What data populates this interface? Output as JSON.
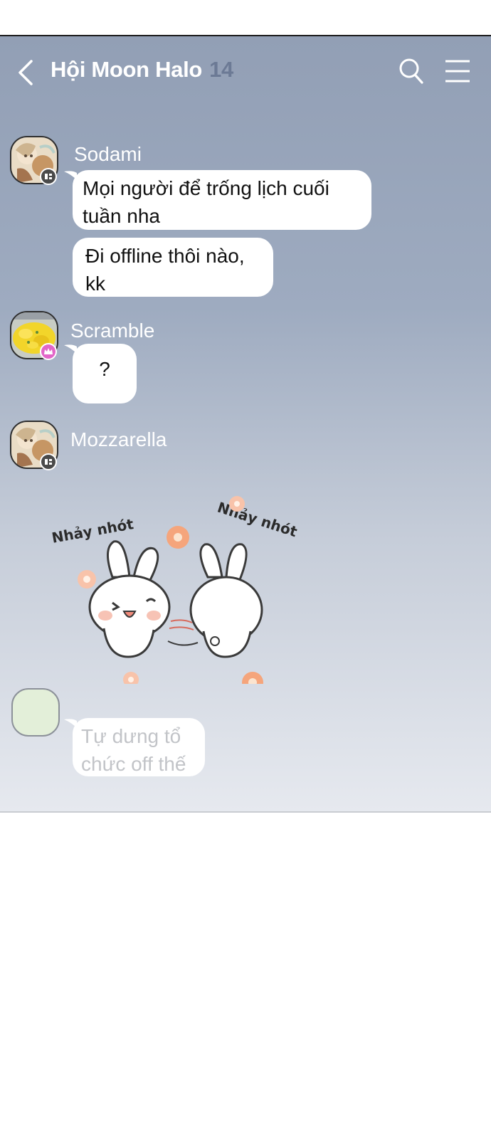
{
  "header": {
    "title": "Hội Moon Halo",
    "member_count": "14"
  },
  "messages": [
    {
      "sender": "Sodami",
      "bubbles": [
        [
          "Mọi người để trống lịch cuối",
          "tuần nha"
        ],
        [
          "Đi offline thôi nào,",
          "kk"
        ]
      ]
    },
    {
      "sender": "Scramble",
      "bubbles": [
        [
          "?"
        ]
      ]
    },
    {
      "sender": "Mozzarella",
      "sticker": {
        "text_left": "Nhảy nhót",
        "text_right": "Nhảy nhót"
      }
    },
    {
      "sender": "",
      "bubbles": [
        [
          "Tự dưng tổ",
          "chức off thế"
        ]
      ]
    }
  ],
  "colors": {
    "chat_bg_top": "#929fb5",
    "chat_bg_bottom": "#e6e9ef",
    "bubble": "#ffffff",
    "member_count": "#6c7a95",
    "badge_pink": "#e266c8"
  },
  "icons": [
    "back-arrow-icon",
    "search-icon",
    "hamburger-menu-icon",
    "member-badge-icon",
    "crown-badge-icon"
  ]
}
